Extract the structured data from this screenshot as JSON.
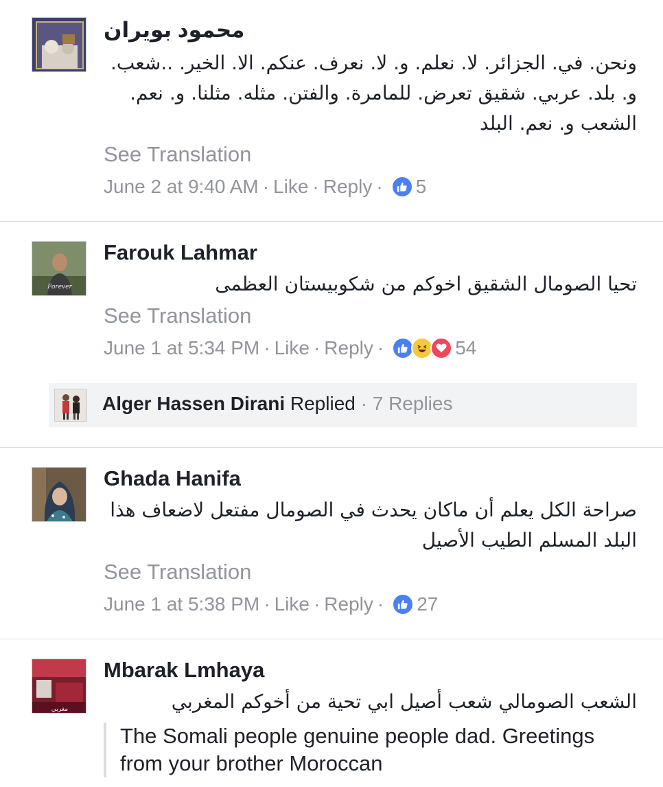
{
  "comments": [
    {
      "name": "محمود بويران",
      "text": "ونحن. في. الجزائر. لا. نعلم. و. لا. نعرف. عنكم. الا. الخير. ..شعب. و. بلد. عربي. شقيق تعرض. للمامرة. والفتن. مثله. مثلنا. و. نعم. الشعب و. نعم. البلد",
      "see_translation": "See Translation",
      "time": "June 2 at 9:40 AM",
      "like": "Like",
      "reply": "Reply",
      "reactions": [
        "like-icon"
      ],
      "reaction_count": "5"
    },
    {
      "name": "Farouk Lahmar",
      "text": "تحيا الصومال الشقيق اخوكم من شكوبيستان العظمى",
      "see_translation": "See Translation",
      "time": "June 1 at 5:34 PM",
      "like": "Like",
      "reply": "Reply",
      "reactions": [
        "like-icon",
        "haha-icon",
        "love-icon"
      ],
      "reaction_count": "54",
      "replies": {
        "name": "Alger Hassen Dirani",
        "replied": "Replied",
        "count": "· 7 Replies"
      }
    },
    {
      "name": "Ghada Hanifa",
      "text": "صراحة الكل يعلم أن ماكان يحدث في الصومال مفتعل لاضعاف هذا البلد المسلم الطيب الأصيل",
      "see_translation": "See Translation",
      "time": "June 1 at 5:38 PM",
      "like": "Like",
      "reply": "Reply",
      "reactions": [
        "like-icon"
      ],
      "reaction_count": "27"
    },
    {
      "name": "Mbarak Lmhaya",
      "text": "الشعب الصومالي شعب أصيل ابي تحية من أخوكم المغربي",
      "translation": "The Somali people genuine people dad. Greetings from your brother Moroccan"
    }
  ],
  "separator": "·",
  "colors": {
    "meta": "#90949c",
    "like_blue": "#4a80f0",
    "love_red": "#f0485a",
    "haha_yellow": "#f7c83a"
  }
}
